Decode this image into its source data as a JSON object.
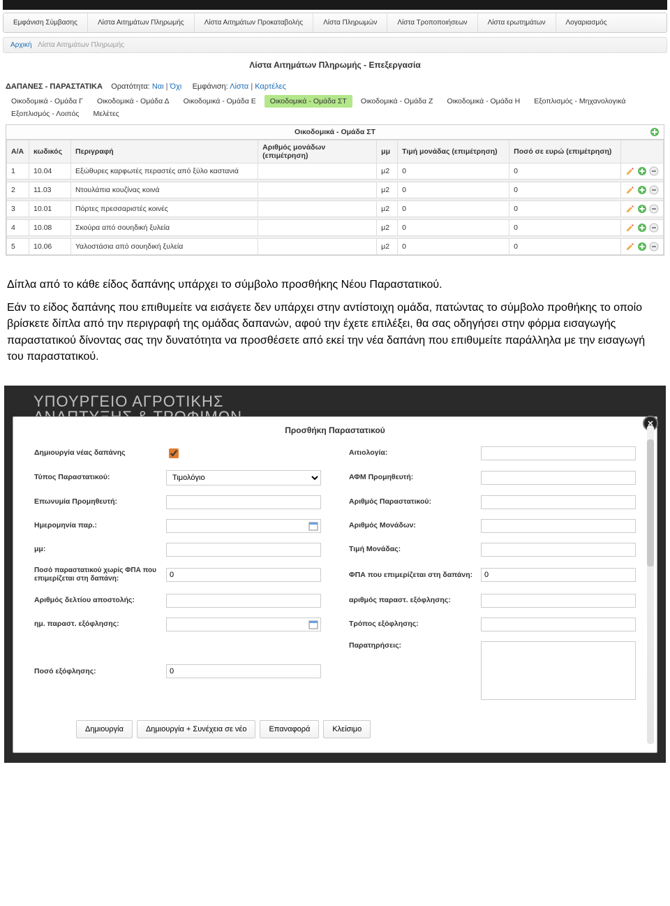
{
  "topnav": {
    "items": [
      "Εμφάνιση Σύμβασης",
      "Λίστα Αιτημάτων Πληρωμής",
      "Λίστα Αιτημάτων Προκαταβολής",
      "Λίστα Πληρωμών",
      "Λίστα Τροποποιήσεων",
      "Λίστα ερωτημάτων",
      "Λογαριασμός"
    ]
  },
  "breadcrumb": {
    "home": "Αρχική",
    "current": "Λίστα Αιτημάτων Πληρωμής"
  },
  "page_title": "Λίστα Αιτημάτων Πληρωμής - Επεξεργασία",
  "section": {
    "label": "ΔΑΠΑΝΕΣ - ΠΑΡΑΣΤΑΤΙΚΑ",
    "visibility_label": "Ορατότητα:",
    "visibility_yes": "Ναι",
    "visibility_no": "Όχι",
    "view_label": "Εμφάνιση:",
    "view_list": "Λίστα",
    "view_cards": "Καρτέλες"
  },
  "group_tabs": [
    "Οικοδομικά - Ομάδα Γ",
    "Οικοδομικά - Ομάδα Δ",
    "Οικοδομικά - Ομάδα Ε",
    "Οικοδομικά - Ομάδα ΣΤ",
    "Οικοδομικά - Ομάδα Ζ",
    "Οικοδομικά - Ομάδα Η",
    "Εξοπλισμός - Μηχανολογικά",
    "Εξοπλισμός - Λοιπός",
    "Μελέτες"
  ],
  "active_tab_index": 3,
  "table": {
    "title": "Οικοδομικά - Ομάδα ΣΤ",
    "headers": {
      "aa": "Α/Α",
      "code": "κωδικός",
      "descr": "Περιγραφή",
      "units": "Αριθμός μονάδων (επιμέτρηση)",
      "mm": "μμ",
      "unit_price": "Τιμή μονάδας (επιμέτρηση)",
      "amount": "Ποσό σε ευρώ (επιμέτρηση)"
    },
    "rows": [
      {
        "aa": "1",
        "code": "10.04",
        "descr": "Εξώθυρες καρφωτές περαστές από ξύλο καστανιά",
        "units": "",
        "mm": "μ2",
        "unit_price": "0",
        "amount": "0"
      },
      {
        "aa": "2",
        "code": "11.03",
        "descr": "Ντουλάπια κουζίνας κοινά",
        "units": "",
        "mm": "μ2",
        "unit_price": "0",
        "amount": "0"
      },
      {
        "aa": "3",
        "code": "10.01",
        "descr": "Πόρτες πρεσσαριστές κοινές",
        "units": "",
        "mm": "μ2",
        "unit_price": "0",
        "amount": "0"
      },
      {
        "aa": "4",
        "code": "10.08",
        "descr": "Σκούρα από σουηδική ξυλεία",
        "units": "",
        "mm": "μ2",
        "unit_price": "0",
        "amount": "0"
      },
      {
        "aa": "5",
        "code": "10.06",
        "descr": "Υαλοστάσια από σουηδική ξυλεία",
        "units": "",
        "mm": "μ2",
        "unit_price": "0",
        "amount": "0"
      }
    ]
  },
  "doc_text": {
    "p1": "Δίπλα από το κάθε είδος δαπάνης υπάρχει το σύμβολο προσθήκης Νέου Παραστατικού.",
    "p2": "Εάν το είδος δαπάνης που επιθυμείτε να εισάγετε δεν υπάρχει στην αντίστοιχη ομάδα, πατώντας το σύμβολο προθήκης το οποίο βρίσκετε δίπλα από την περιγραφή της ομάδας δαπανών, αφού την έχετε επιλέξει, θα σας οδηγήσει στην φόρμα εισαγωγής παραστατικού δίνοντας σας την δυνατότητα να προσθέσετε από εκεί την νέα δαπάνη που επιθυμείτε παράλληλα με την εισαγωγή του παραστατικού."
  },
  "ministry_line1": "ΥΠΟΥΡΓΕΙΟ ΑΓΡΟΤΙΚΗΣ",
  "ministry_line2": "ΑΝΑΠΤΥΞΗΣ & ΤΡΟΦΙΜΩΝ",
  "modal": {
    "title": "Προσθήκη Παραστατικού",
    "left": {
      "new_expense": "Δημιουργία νέας δαπάνης",
      "doc_type": "Τύπος Παραστατικού:",
      "doc_type_value": "Τιμολόγιο",
      "supplier_name": "Επωνυμία Προμηθευτή:",
      "doc_date": "Ημερομηνία παρ.:",
      "mm": "μμ:",
      "amount_ex_vat": "Ποσό παραστατικού χωρίς ΦΠΑ που επιμερίζεται στη δαπάνη:",
      "amount_ex_vat_value": "0",
      "delivery_no": "Αριθμός δελτίου αποστολής:",
      "payoff_date": "ημ. παραστ. εξόφλησης:",
      "payoff_amount": "Ποσό εξόφλησης:",
      "payoff_amount_value": "0"
    },
    "right": {
      "reason": "Αιτιολογία:",
      "supplier_afm": "ΑΦΜ Προμηθευτή:",
      "doc_no": "Αριθμός Παραστατικού:",
      "units_no": "Αριθμός Μονάδων:",
      "unit_price": "Τιμή Μονάδας:",
      "vat": "ΦΠΑ που επιμερίζεται στη δαπάνη:",
      "vat_value": "0",
      "payoff_doc_no": "αριθμός παραστ. εξόφλησης:",
      "payoff_method": "Τρόπος εξόφλησης:",
      "notes": "Παρατηρήσεις:"
    },
    "buttons": {
      "create": "Δημιουργία",
      "create_next": "Δημιουργία + Συνέχεια σε νέο",
      "reset": "Επαναφορά",
      "close": "Κλείσιμο"
    }
  }
}
